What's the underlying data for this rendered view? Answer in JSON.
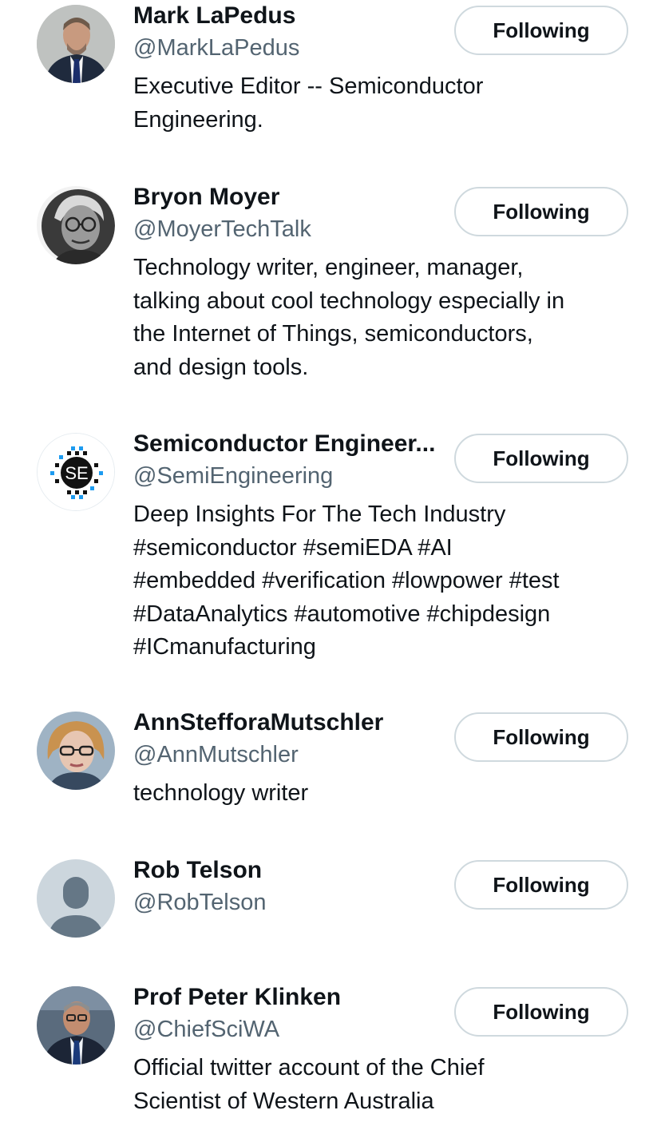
{
  "accounts": [
    {
      "name": "Mark LaPedus",
      "handle": "@MarkLaPedus",
      "bio": [
        "Executive Editor -- Semiconductor",
        "Engineering."
      ],
      "button": "Following",
      "avatar": "photo-man-suit-icon"
    },
    {
      "name": "Bryon Moyer",
      "handle": "@MoyerTechTalk",
      "bio": [
        "Technology writer, engineer, manager,",
        "talking about cool technology especially in",
        "the Internet of Things, semiconductors,",
        "and design tools."
      ],
      "button": "Following",
      "avatar": "photo-man-glasses-bw-icon"
    },
    {
      "name": "Semiconductor Engineer...",
      "handle": "@SemiEngineering",
      "bio": [
        "Deep Insights For The Tech Industry",
        "#semiconductor #semiEDA #AI",
        "#embedded #verification #lowpower #test",
        "#DataAnalytics #automotive #chipdesign",
        "#ICmanufacturing"
      ],
      "button": "Following",
      "avatar": "se-logo-icon",
      "logo_text": "SE"
    },
    {
      "name": "AnnStefforaMutschler",
      "handle": "@AnnMutschler",
      "bio": [
        "technology writer"
      ],
      "button": "Following",
      "avatar": "photo-woman-glasses-icon"
    },
    {
      "name": "Rob Telson",
      "handle": "@RobTelson",
      "bio": [],
      "button": "Following",
      "avatar": "default-person-icon"
    },
    {
      "name": "Prof Peter Klinken",
      "handle": "@ChiefSciWA",
      "bio": [
        "Official twitter account of the Chief",
        "Scientist of Western Australia"
      ],
      "button": "Following",
      "avatar": "photo-man-suit-tie-icon"
    }
  ],
  "colors": {
    "text": "#0f1419",
    "secondary": "#536471",
    "border": "#cfd9de",
    "accent_blue": "#1d9bf0"
  }
}
